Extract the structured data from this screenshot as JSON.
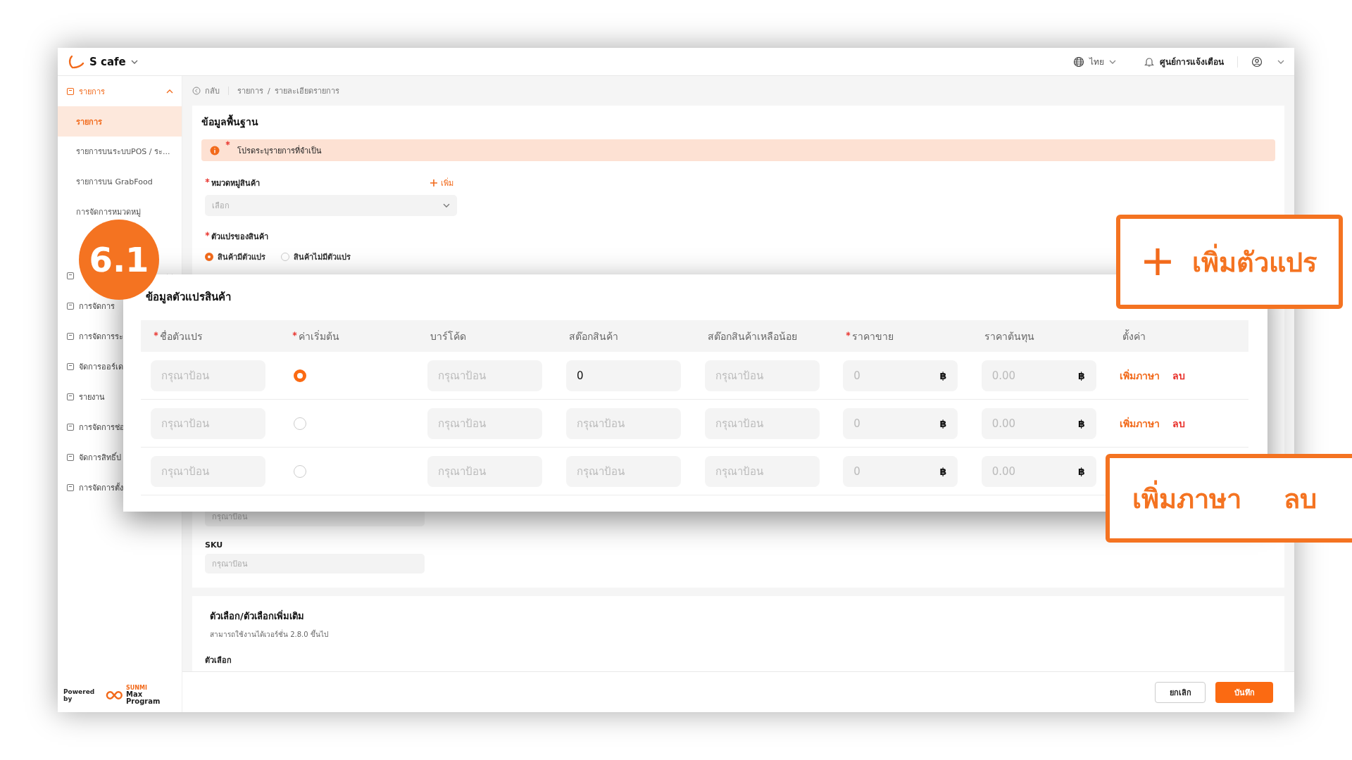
{
  "app": {
    "name": "S cafe"
  },
  "header": {
    "language": "ไทย",
    "notifications": "ศูนย์การแจ้งเตือน"
  },
  "sidebar": {
    "items": [
      {
        "kind": "group",
        "label": "รายการ",
        "expanded": true,
        "selected": true,
        "children": [
          {
            "label": "รายการ",
            "selected": true
          },
          {
            "label": "รายการบนระบบPOS / ระ...",
            "selected": false
          },
          {
            "label": "รายการบน GrabFood",
            "selected": false
          },
          {
            "label": "การจัดการหมวดหมู่",
            "selected": false
          }
        ]
      },
      {
        "kind": "group",
        "expanded": false
      },
      {
        "kind": "link",
        "label": "การจัดการ",
        "selected": false
      },
      {
        "kind": "link",
        "label": "การจัดการระ",
        "selected": false
      },
      {
        "kind": "link",
        "label": "จัดการออร์เด",
        "selected": false
      },
      {
        "kind": "link",
        "label": "รายงาน",
        "selected": false
      },
      {
        "kind": "link",
        "label": "การจัดการช่อ",
        "selected": false
      },
      {
        "kind": "link",
        "label": "จัดการสิทธิ์ป",
        "selected": false
      },
      {
        "kind": "link",
        "label": "การจัดการตั้ง",
        "selected": false
      }
    ],
    "powered_by": "Powered by",
    "brand_small": "SUNMI",
    "brand": "Max Program"
  },
  "breadcrumb": {
    "back": "กลับ",
    "items": [
      "รายการ",
      "รายละเอียดรายการ"
    ],
    "separator": "/"
  },
  "basic_info": {
    "title": "ข้อมูลพื้นฐาน",
    "alert": {
      "text": "โปรดระบุรายการที่จำเป็น",
      "required": true
    },
    "category": {
      "label": "หมวดหมู่สินค้า",
      "required": true,
      "add": "เพิ่ม",
      "placeholder": "เลือก"
    },
    "variant_type": {
      "label": "ตัวแปรของสินค้า",
      "required": true,
      "options": [
        {
          "label": "สินค้ามีตัวแปร",
          "selected": true
        },
        {
          "label": "สินค้าไม่มีตัวแปร",
          "selected": false
        }
      ]
    },
    "partial_field": {
      "placeholder": "กรุณาป้อน"
    },
    "sku": {
      "label": "SKU",
      "placeholder": "กรุณาป้อน"
    }
  },
  "options_section": {
    "title": "ตัวเลือก/ตัวเลือกเพิ่มเติม",
    "note": "สามารถใช้งานได้เวอร์ชั่น 2.8.0 ขึ้นไป",
    "label": "ตัวเลือก"
  },
  "footer": {
    "cancel": "ยกเลิก",
    "save": "บันทึก"
  },
  "variant_dialog": {
    "title": "ข้อมูลตัวแปรสินค้า",
    "columns": [
      {
        "label": "ชื่อตัวแปร",
        "required": true
      },
      {
        "label": "ค่าเริ่มต้น",
        "required": true
      },
      {
        "label": "บาร์โค้ด",
        "required": false
      },
      {
        "label": "สต๊อกสินค้า",
        "required": false
      },
      {
        "label": "สต๊อกสินค้าเหลือน้อย",
        "required": false
      },
      {
        "label": "ราคาขาย",
        "required": true
      },
      {
        "label": "ราคาต้นทุน",
        "required": false
      },
      {
        "label": "ตั้งค่า",
        "required": false
      }
    ],
    "rows": [
      {
        "name": {
          "placeholder": "กรุณาป้อน"
        },
        "default": {
          "selected": true
        },
        "barcode": {
          "placeholder": "กรุณาป้อน"
        },
        "stock": {
          "value": "0"
        },
        "low_stock": {
          "placeholder": "กรุณาป้อน"
        },
        "price": {
          "placeholder": "0",
          "currency": "฿"
        },
        "cost": {
          "placeholder": "0.00",
          "currency": "฿"
        },
        "actions": [
          {
            "kind": "add",
            "label": "เพิ่มภาษา"
          },
          {
            "kind": "delete",
            "label": "ลบ"
          }
        ]
      },
      {
        "name": {
          "placeholder": "กรุณาป้อน"
        },
        "default": {
          "selected": false
        },
        "barcode": {
          "placeholder": "กรุณาป้อน"
        },
        "stock": {
          "placeholder": "กรุณาป้อน"
        },
        "low_stock": {
          "placeholder": "กรุณาป้อน"
        },
        "price": {
          "placeholder": "0",
          "currency": "฿"
        },
        "cost": {
          "placeholder": "0.00",
          "currency": "฿"
        },
        "actions": [
          {
            "kind": "add",
            "label": "เพิ่มภาษา"
          },
          {
            "kind": "delete",
            "label": "ลบ"
          }
        ]
      },
      {
        "name": {
          "placeholder": "กรุณาป้อน"
        },
        "default": {
          "selected": false
        },
        "barcode": {
          "placeholder": "กรุณาป้อน"
        },
        "stock": {
          "placeholder": "กรุณาป้อน"
        },
        "low_stock": {
          "placeholder": "กรุณาป้อน"
        },
        "price": {
          "placeholder": "0",
          "currency": "฿"
        },
        "cost": {
          "placeholder": "0.00",
          "currency": "฿"
        }
      }
    ]
  },
  "callouts": {
    "step": "6.1",
    "add_variant": "เพิ่มตัวแปร",
    "row_actions": [
      "เพิ่มภาษา",
      "ลบ"
    ]
  }
}
